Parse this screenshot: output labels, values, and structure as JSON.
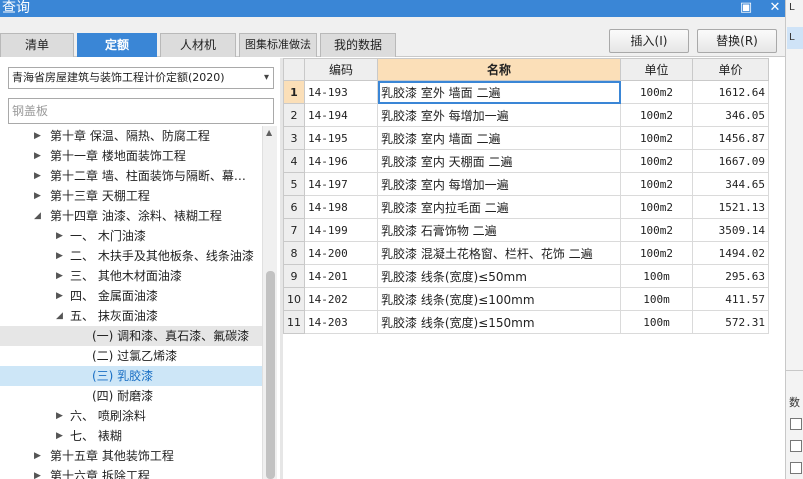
{
  "window": {
    "title": "查询",
    "minimize_glyph": "▣",
    "close_glyph": "✕"
  },
  "tabs": [
    {
      "label": "清单",
      "active": false
    },
    {
      "label": "定额",
      "active": true
    },
    {
      "label": "人材机",
      "active": false
    },
    {
      "label": "图集标准做法",
      "active": false
    },
    {
      "label": "我的数据",
      "active": false
    }
  ],
  "buttons": {
    "insert": "插入(I)",
    "replace": "替换(R)"
  },
  "filter": {
    "quota_library": "青海省房屋建筑与装饰工程计价定额(2020)",
    "search_value": "",
    "search_placeholder": "钢盖板"
  },
  "tree": [
    {
      "label": "第十章 保温、隔热、防腐工程",
      "arrow": "▶",
      "level": 0,
      "highlight": ""
    },
    {
      "label": "第十一章 楼地面装饰工程",
      "arrow": "▶",
      "level": 0,
      "highlight": ""
    },
    {
      "label": "第十二章 墙、柱面装饰与隔断、幕…",
      "arrow": "▶",
      "level": 0,
      "highlight": ""
    },
    {
      "label": "第十三章 天棚工程",
      "arrow": "▶",
      "level": 0,
      "highlight": ""
    },
    {
      "label": "第十四章 油漆、涂料、裱糊工程",
      "arrow": "◢",
      "level": 0,
      "highlight": ""
    },
    {
      "label": "一、 木门油漆",
      "arrow": "▶",
      "level": 1,
      "highlight": ""
    },
    {
      "label": "二、 木扶手及其他板条、线条油漆",
      "arrow": "▶",
      "level": 1,
      "highlight": ""
    },
    {
      "label": "三、 其他木材面油漆",
      "arrow": "▶",
      "level": 1,
      "highlight": ""
    },
    {
      "label": "四、 金属面油漆",
      "arrow": "▶",
      "level": 1,
      "highlight": ""
    },
    {
      "label": "五、 抹灰面油漆",
      "arrow": "◢",
      "level": 1,
      "highlight": ""
    },
    {
      "label": "(一) 调和漆、真石漆、氟碳漆",
      "arrow": "",
      "level": 2,
      "highlight": "grey"
    },
    {
      "label": "(二) 过氯乙烯漆",
      "arrow": "",
      "level": 2,
      "highlight": ""
    },
    {
      "label": "(三) 乳胶漆",
      "arrow": "",
      "level": 2,
      "highlight": "blue"
    },
    {
      "label": "(四) 耐磨漆",
      "arrow": "",
      "level": 2,
      "highlight": ""
    },
    {
      "label": "六、 喷刷涂料",
      "arrow": "▶",
      "level": 1,
      "highlight": ""
    },
    {
      "label": "七、 裱糊",
      "arrow": "▶",
      "level": 1,
      "highlight": ""
    },
    {
      "label": "第十五章 其他装饰工程",
      "arrow": "▶",
      "level": 0,
      "highlight": ""
    },
    {
      "label": "第十六章 拆除工程",
      "arrow": "▶",
      "level": 0,
      "highlight": ""
    }
  ],
  "grid": {
    "headers": {
      "code": "编码",
      "name": "名称",
      "unit": "单位",
      "price": "单价"
    },
    "rows": [
      {
        "idx": "1",
        "code": "14-193",
        "name": "乳胶漆 室外 墙面 二遍",
        "unit": "100m2",
        "price": "1612.64",
        "current": true
      },
      {
        "idx": "2",
        "code": "14-194",
        "name": "乳胶漆 室外 每增加一遍",
        "unit": "100m2",
        "price": "346.05",
        "current": false
      },
      {
        "idx": "3",
        "code": "14-195",
        "name": "乳胶漆 室内 墙面 二遍",
        "unit": "100m2",
        "price": "1456.87",
        "current": false
      },
      {
        "idx": "4",
        "code": "14-196",
        "name": "乳胶漆 室内 天棚面 二遍",
        "unit": "100m2",
        "price": "1667.09",
        "current": false
      },
      {
        "idx": "5",
        "code": "14-197",
        "name": "乳胶漆 室内 每增加一遍",
        "unit": "100m2",
        "price": "344.65",
        "current": false
      },
      {
        "idx": "6",
        "code": "14-198",
        "name": "乳胶漆 室内拉毛面 二遍",
        "unit": "100m2",
        "price": "1521.13",
        "current": false
      },
      {
        "idx": "7",
        "code": "14-199",
        "name": "乳胶漆 石膏饰物 二遍",
        "unit": "100m2",
        "price": "3509.14",
        "current": false
      },
      {
        "idx": "8",
        "code": "14-200",
        "name": "乳胶漆 混凝土花格窗、栏杆、花饰 二遍",
        "unit": "100m2",
        "price": "1494.02",
        "current": false
      },
      {
        "idx": "9",
        "code": "14-201",
        "name": "乳胶漆 线条(宽度)≤50mm",
        "unit": "100m",
        "price": "295.63",
        "current": false
      },
      {
        "idx": "10",
        "code": "14-202",
        "name": "乳胶漆 线条(宽度)≤100mm",
        "unit": "100m",
        "price": "411.57",
        "current": false
      },
      {
        "idx": "11",
        "code": "14-203",
        "name": "乳胶漆 线条(宽度)≤150mm",
        "unit": "100m",
        "price": "572.31",
        "current": false
      }
    ]
  },
  "right_strip": {
    "letter_top": "L",
    "letter_mid": "L",
    "side_text": "数"
  }
}
